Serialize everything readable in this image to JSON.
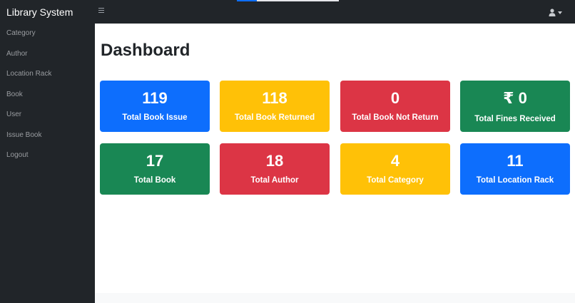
{
  "app": {
    "brand": "Library System"
  },
  "sidebar": {
    "items": [
      {
        "label": "Category"
      },
      {
        "label": "Author"
      },
      {
        "label": "Location Rack"
      },
      {
        "label": "Book"
      },
      {
        "label": "User"
      },
      {
        "label": "Issue Book"
      },
      {
        "label": "Logout"
      }
    ]
  },
  "main": {
    "title": "Dashboard"
  },
  "cards": [
    {
      "value": "119",
      "label": "Total Book Issue",
      "color": "#0d6efd"
    },
    {
      "value": "118",
      "label": "Total Book Returned",
      "color": "#ffc107"
    },
    {
      "value": "0",
      "label": "Total Book Not Return",
      "color": "#dc3545"
    },
    {
      "value": "₹ 0",
      "label": "Total Fines Received",
      "color": "#198754"
    },
    {
      "value": "17",
      "label": "Total Book",
      "color": "#198754"
    },
    {
      "value": "18",
      "label": "Total Author",
      "color": "#dc3545"
    },
    {
      "value": "4",
      "label": "Total Category",
      "color": "#ffc107"
    },
    {
      "value": "11",
      "label": "Total Location Rack",
      "color": "#0d6efd"
    }
  ],
  "icons": {
    "menu": "hamburger-icon",
    "user": "user-icon",
    "dropdown": "caret-down-icon"
  },
  "colors": {
    "navbar": "#212529",
    "sidebar_text": "#9a9da1"
  }
}
